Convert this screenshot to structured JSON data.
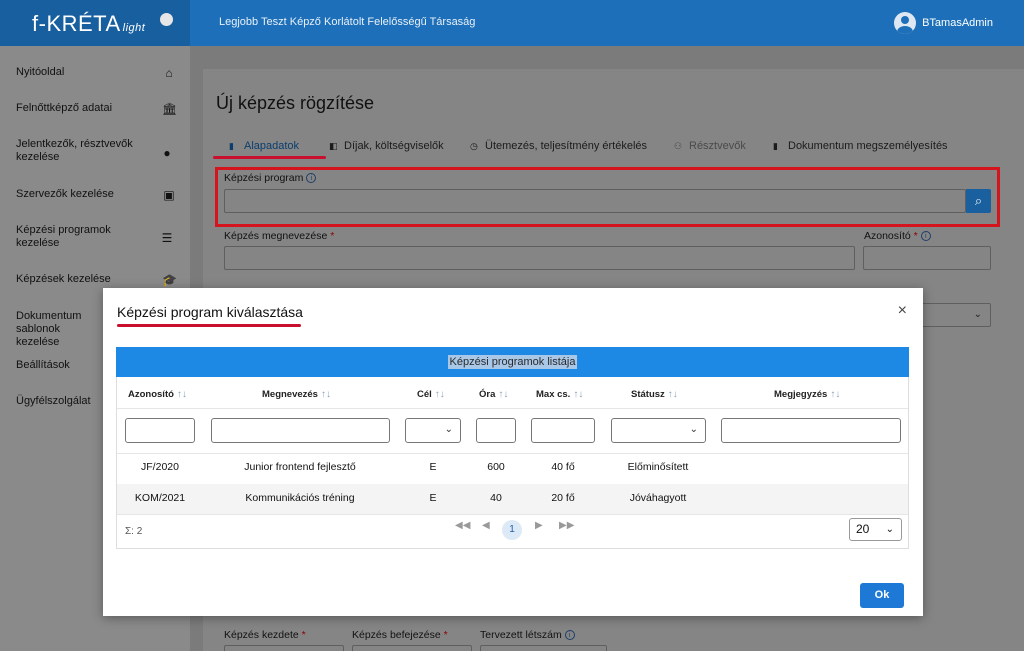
{
  "header": {
    "logo_text": "f-KRÉTA",
    "logo_suffix": "light",
    "org_name": "Legjobb Teszt Képző Korlátolt Felelősségű Társaság",
    "username": "BTamasAdmin"
  },
  "sidebar": {
    "items": [
      {
        "label": "Nyitóoldal",
        "icon": "home-icon",
        "glyph": "⌂"
      },
      {
        "label": "Felnőttképző adatai",
        "icon": "institution-icon",
        "glyph": "🏛"
      },
      {
        "label": "Jelentkezők, résztvevők kezelése",
        "icon": "person-icon",
        "glyph": "●"
      },
      {
        "label": "Szervezők kezelése",
        "icon": "contact-card-icon",
        "glyph": "▣"
      },
      {
        "label": "Képzési programok kezelése",
        "icon": "list-icon",
        "glyph": "☰"
      },
      {
        "label": "Képzések kezelése",
        "icon": "graduation-cap-icon",
        "glyph": "🎓"
      },
      {
        "label": "Dokumentum sablonok kezelése",
        "icon": "document-icon",
        "glyph": ""
      },
      {
        "label": "Beállítások",
        "icon": "settings-icon",
        "glyph": ""
      },
      {
        "label": "Ügyfélszolgálat",
        "icon": "support-icon",
        "glyph": ""
      }
    ]
  },
  "page": {
    "title": "Új képzés rögzítése",
    "tabs": [
      {
        "label": "Alapadatok",
        "icon": "document-icon",
        "state": "active"
      },
      {
        "label": "Díjak, költségviselők",
        "icon": "money-icon",
        "state": "normal"
      },
      {
        "label": "Ütemezés, teljesítmény értékelés",
        "icon": "clock-icon",
        "state": "normal"
      },
      {
        "label": "Résztvevők",
        "icon": "people-icon",
        "state": "disabled"
      },
      {
        "label": "Dokumentum megszemélyesítés",
        "icon": "book-icon",
        "state": "normal"
      }
    ],
    "fields": {
      "program_label": "Képzési program",
      "program_value": "",
      "name_label": "Képzés megnevezése",
      "name_value": "",
      "id_label": "Azonosító",
      "id_value": "",
      "start_label": "Képzés kezdete",
      "end_label": "Képzés befejezése",
      "planned_label": "Tervezett létszám",
      "required_mark": "*"
    }
  },
  "modal": {
    "title": "Képzési program kiválasztása",
    "close_glyph": "×",
    "list_title": "Képzési programok listája",
    "columns": [
      "Azonosító",
      "Megnevezés",
      "Cél",
      "Óra",
      "Max cs.",
      "Státusz",
      "Megjegyzés"
    ],
    "rows": [
      {
        "id": "JF/2020",
        "name": "Junior frontend fejlesztő",
        "goal": "E",
        "hours": "600",
        "max": "40 fő",
        "status": "Előminősített",
        "note": ""
      },
      {
        "id": "KOM/2021",
        "name": "Kommunikációs tréning",
        "goal": "E",
        "hours": "40",
        "max": "20 fő",
        "status": "Jóváhagyott",
        "note": ""
      }
    ],
    "total": "Σ: 2",
    "current_page": "1",
    "page_size": "20",
    "ok_label": "Ok"
  },
  "colors": {
    "primary": "#1c6fb8",
    "highlight": "#d5141e",
    "ok_button": "#1e79d6"
  }
}
